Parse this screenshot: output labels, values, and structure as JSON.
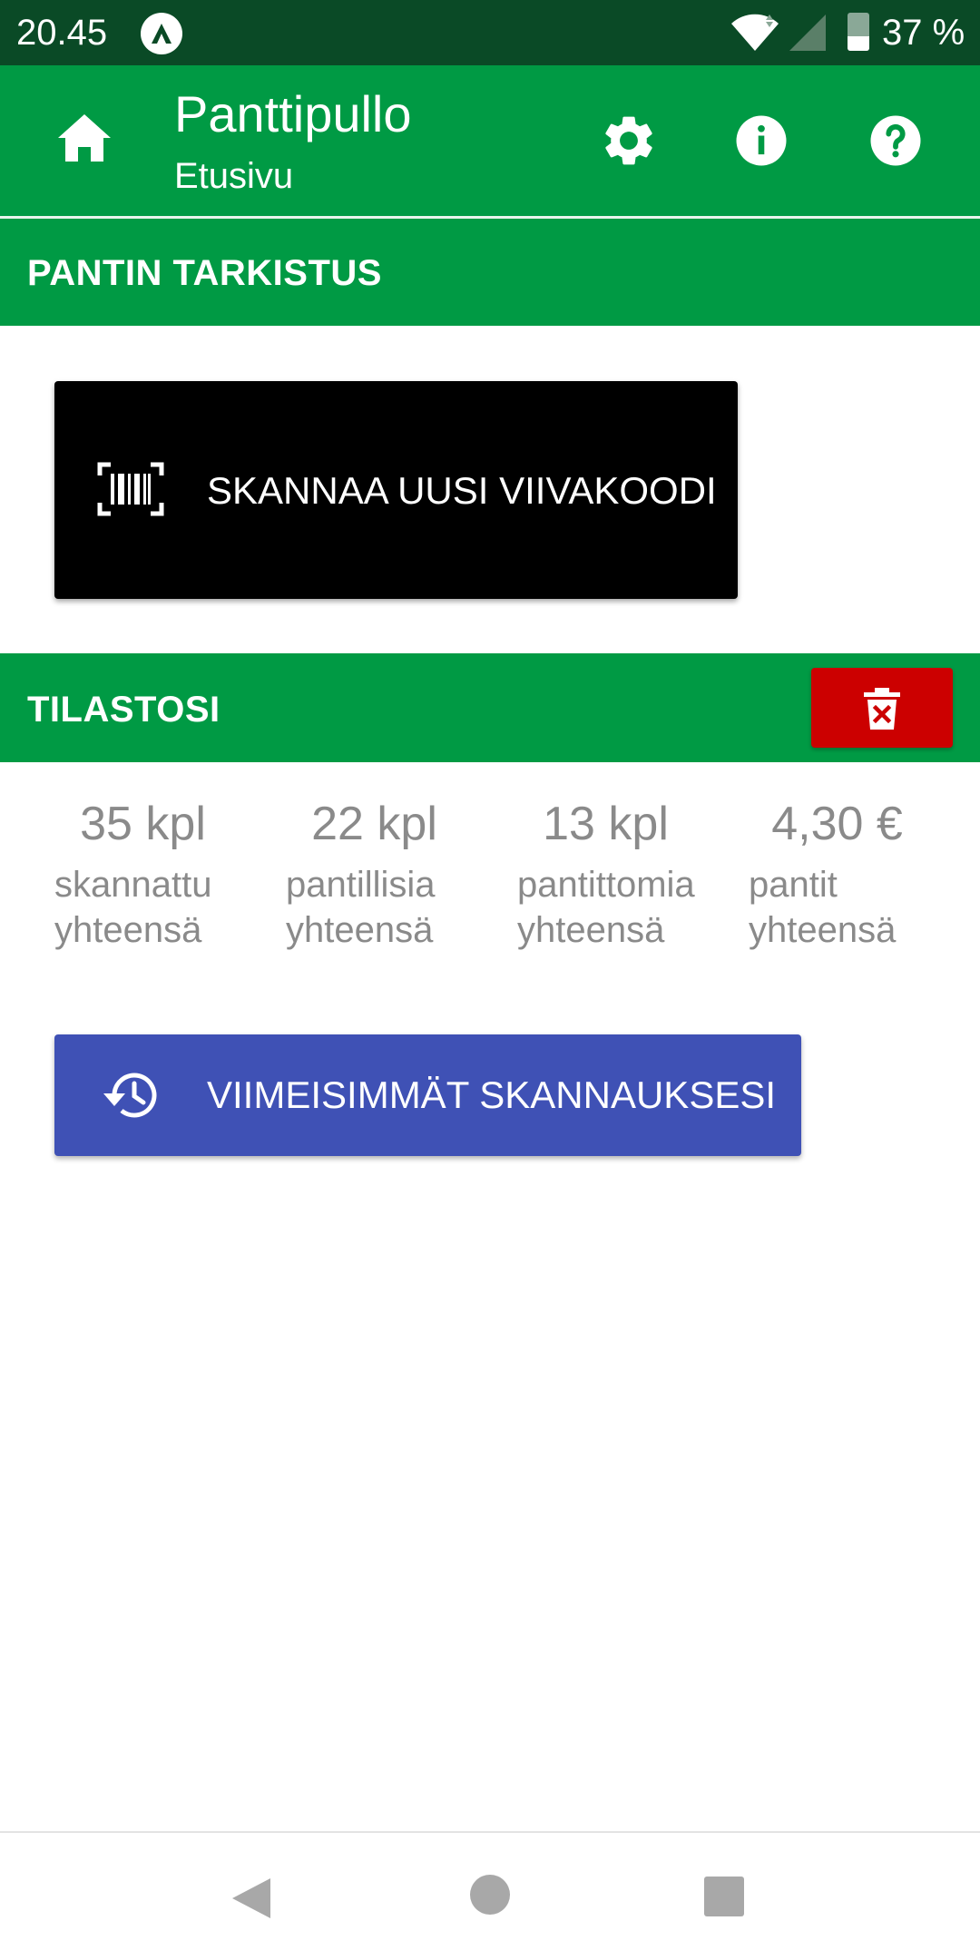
{
  "status_bar": {
    "time": "20.45",
    "battery_text": "37 %",
    "battery_level": 0.37,
    "icons": [
      "app-notification-icon",
      "wifi-icon",
      "signal-icon",
      "battery-icon"
    ]
  },
  "app_bar": {
    "title": "Panttipullo",
    "subtitle": "Etusivu",
    "icons": [
      "home-icon",
      "gear-icon",
      "info-icon",
      "help-icon"
    ]
  },
  "sections": {
    "check_title": "PANTIN TARKISTUS",
    "stats_title": "TILASTOSI"
  },
  "scan_button": {
    "label": "SKANNAA UUSI VIIVAKOODI",
    "icon": "barcode-scan-icon"
  },
  "clear_button": {
    "icon": "delete-icon"
  },
  "stats": [
    {
      "value": "35 kpl",
      "label": "skannattu\nyhteensä"
    },
    {
      "value": "22 kpl",
      "label": "pantillisia\nyhteensä"
    },
    {
      "value": "13 kpl",
      "label": "pantittomia\nyhteensä"
    },
    {
      "value": "4,30 €",
      "label": "pantit\nyhteensä"
    }
  ],
  "recent_button": {
    "label": "VIIMEISIMMÄT SKANNAUKSESI",
    "icon": "history-icon"
  },
  "nav_bar": {
    "icons": [
      "back-icon",
      "home-circle-icon",
      "recents-icon"
    ]
  },
  "colors": {
    "status_bar": "#0a4a26",
    "primary": "#009a44",
    "scan_button": "#000000",
    "delete": "#cc0000",
    "accent": "#3f51b5",
    "stat_text": "#8a8a8a"
  }
}
